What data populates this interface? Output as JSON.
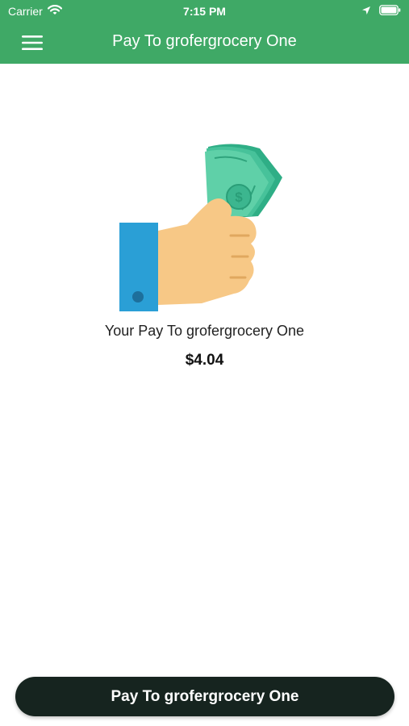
{
  "status_bar": {
    "carrier": "Carrier",
    "time": "7:15 PM",
    "icons": [
      "wifi-icon",
      "location-arrow-icon",
      "battery-icon"
    ]
  },
  "header": {
    "title": "Pay To grofergrocery One",
    "menu_icon": "hamburger-menu-icon",
    "background_color": "#3fa966"
  },
  "main": {
    "illustration": "hand-holding-cash-icon",
    "caption": "Your Pay To grofergrocery One",
    "amount": "$4.04"
  },
  "footer": {
    "button_label": "Pay To grofergrocery One",
    "button_color": "#16241f"
  }
}
